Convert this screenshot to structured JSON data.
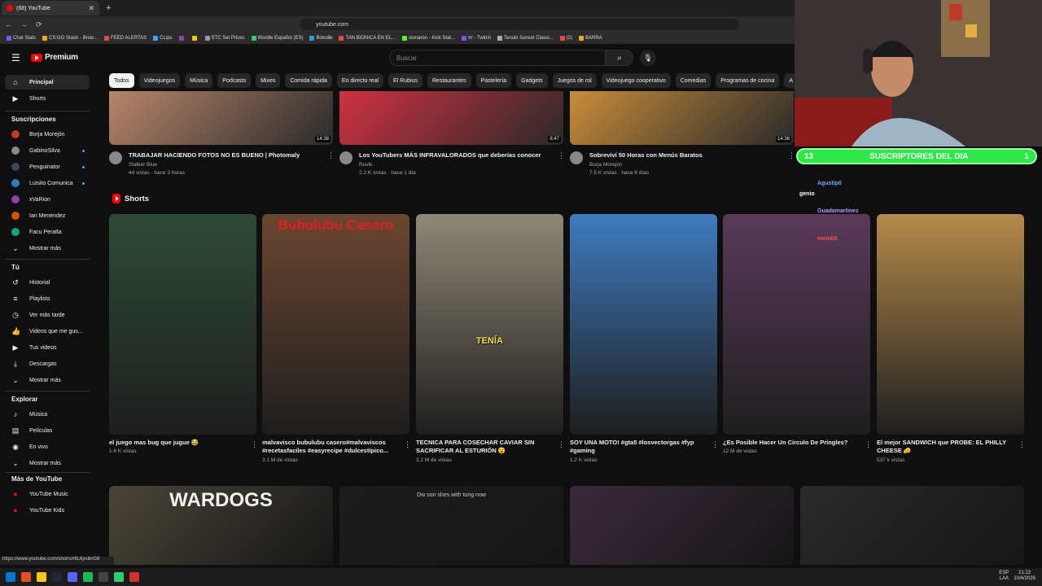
{
  "browser": {
    "tab_title": "(68) YouTube",
    "url": "youtube.com",
    "bookmarks": [
      {
        "label": "Chat Stats",
        "color": "#6b5cff"
      },
      {
        "label": "CS:GO Stash - Brow...",
        "color": "#f5a623"
      },
      {
        "label": "FEED ALERTAS",
        "color": "#e74c3c"
      },
      {
        "label": "CLips",
        "color": "#3ea6ff"
      },
      {
        "label": "",
        "color": "#8e44ad"
      },
      {
        "label": "",
        "color": "#f1c40f"
      },
      {
        "label": "STC Set Prices",
        "color": "#999"
      },
      {
        "label": "Wordle Español (ES)",
        "color": "#2ecc71"
      },
      {
        "label": "Boludle",
        "color": "#3498db"
      },
      {
        "label": "TAN BIONICA EN EL...",
        "color": "#e74c3c"
      },
      {
        "label": "sionaron - Kick Stat...",
        "color": "#53fc18"
      },
      {
        "label": "trr - Twitch",
        "color": "#9146ff"
      },
      {
        "label": "Tenuki Sunset Classi...",
        "color": "#aaa"
      },
      {
        "label": "(2)",
        "color": "#e74c3c"
      },
      {
        "label": "BARRA",
        "color": "#f5a623"
      }
    ],
    "status_url": "https://www.youtube.com/shorts/r6L6jvubrG8"
  },
  "header": {
    "logo_text": "Premium",
    "search_placeholder": "Buscar"
  },
  "chips": [
    "Todos",
    "Videojuegos",
    "Música",
    "Podcasts",
    "Mixes",
    "Comida rápida",
    "En directo real",
    "El Rubius",
    "Restaurantes",
    "Pastelería",
    "Gadgets",
    "Juegos de rol",
    "Videojuego cooperativo",
    "Comedias",
    "Programas de cocina",
    "A"
  ],
  "sidebar": {
    "main": [
      {
        "label": "Principal",
        "icon": "home-icon"
      },
      {
        "label": "Shorts",
        "icon": "shorts-icon"
      }
    ],
    "subs_heading": "Suscripciones",
    "subs": [
      {
        "label": "Borja Morejón",
        "color": "#c0392b"
      },
      {
        "label": "GabinoSilva",
        "color": "#7f8c8d"
      },
      {
        "label": "Penguinator",
        "color": "#34495e"
      },
      {
        "label": "Luisito Comunica",
        "color": "#2980b9"
      },
      {
        "label": "xVaRion",
        "color": "#8e44ad"
      },
      {
        "label": "Ian Menendez",
        "color": "#d35400"
      },
      {
        "label": "Facu Peralta",
        "color": "#16a085"
      }
    ],
    "show_more": "Mostrar más",
    "you_heading": "Tú",
    "you": [
      "Historial",
      "Playlists",
      "Ver más tarde",
      "Videos que me gus...",
      "Tus videos",
      "Descargas",
      "Mostrar más"
    ],
    "explore_heading": "Explorar",
    "explore": [
      "Música",
      "Películas",
      "En vivo",
      "Mostrar más"
    ],
    "more_heading": "Más de YouTube",
    "more": [
      "YouTube Music",
      "YouTube Kids"
    ]
  },
  "videos": [
    {
      "title": "TRABAJAR HACIENDO FOTOS NO ES BUENO | Photomaly",
      "channel": "Stalker Blue",
      "meta": "44 vistas · hace 3 horas",
      "duration": "14:38",
      "color": "#b8856a"
    },
    {
      "title": "Los YouTubers MÁS INFRAVALORADOS que deberías conocer",
      "channel": "Ruvik·",
      "meta": "2.2 K vistas · hace 1 día",
      "duration": "8:47",
      "color": "#d03040"
    },
    {
      "title": "Sobreviví 50 Horas con Menús Baratos",
      "channel": "Borja Morejón",
      "meta": "7.5 K vistas · hace 8 días",
      "duration": "14:36",
      "color": "#c98c3a"
    }
  ],
  "shorts_heading": "Shorts",
  "shorts": [
    {
      "title": "el juego mas bug que jugue 😂",
      "meta": "1.6 K vistas",
      "color": "#2e4a36"
    },
    {
      "title": "malvavisco bubulubu casero#malvaviscos #recetasfaciles #easyrecipe #dulcestípico...",
      "meta": "3.1 M de vistas",
      "color": "#6b4630",
      "overlay": "Bubulubu Casero"
    },
    {
      "title": "TECNICA PARA COSECHAR CAVIAR SIN SACRIFICAR AL ESTURIÓN 😮",
      "meta": "3.2 M de vistas",
      "color": "#8f8878",
      "overlay": "TENÍA"
    },
    {
      "title": "SOY UNA MOTO! #gta5 #losvectorgas #fyp #gaming",
      "meta": "1.2 K vistas",
      "color": "#3e7bbf"
    },
    {
      "title": "¿Es Posible Hacer Un Circulo De Pringles?",
      "meta": "12 M de vistas",
      "color": "#5a3a5a"
    },
    {
      "title": "El mejor SANDWICH que PROBE: EL PHILLY CHEESE 🧀",
      "meta": "537 k vistas",
      "color": "#b58a4a"
    }
  ],
  "bottom_row": [
    {
      "label": "WARDOGS",
      "color": "#4a4538"
    },
    {
      "label": "Dw son shes with tung now",
      "color": "#1c1c1c"
    },
    {
      "label": "",
      "color": "#3a2a3a"
    },
    {
      "label": "",
      "color": "#2a2a2a"
    }
  ],
  "stream": {
    "subs_count": "13",
    "subs_label": "SUSCRIPTORES DEL DIA",
    "subs_right": "1",
    "chat": [
      {
        "user": "Agustip0",
        "text": "",
        "color": "#6fa8ff"
      },
      {
        "user": "genio",
        "text": "",
        "color": "#ffffff"
      },
      {
        "user": "Guadamartinez",
        "text": "",
        "color": "#b59cff"
      },
      {
        "user": "nanu00",
        "text": "",
        "color": "#ff4d4d"
      }
    ]
  },
  "taskbar": {
    "lang": "ESP",
    "lang2": "LAA",
    "time": "21:22",
    "date": "10/4/2026"
  }
}
